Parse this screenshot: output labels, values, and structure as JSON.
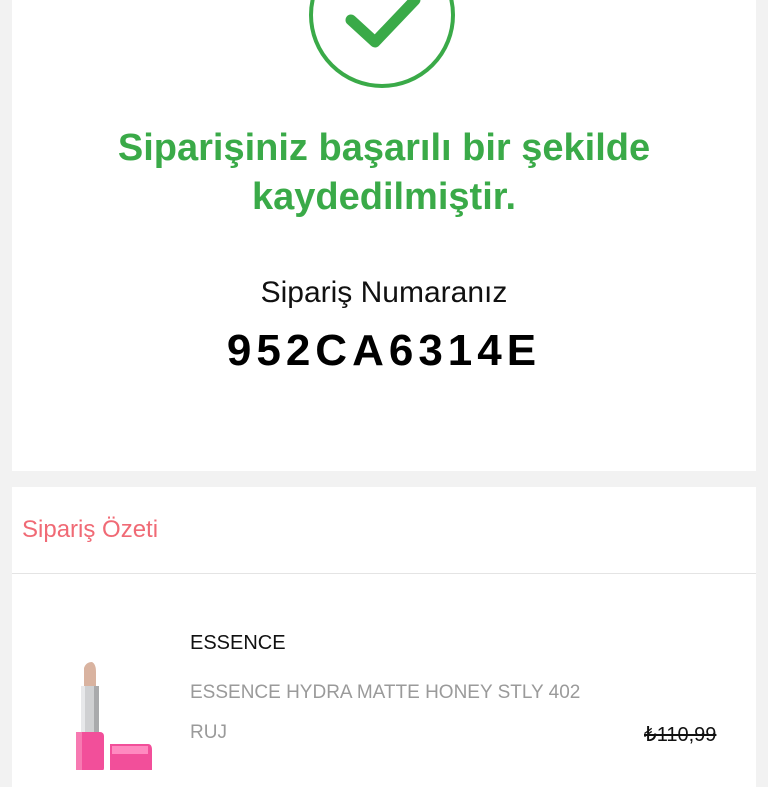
{
  "confirmation": {
    "message": "Siparişiniz başarılı bir şekilde kaydedilmiştir.",
    "order_label": "Sipariş Numaranız",
    "order_number": "952CA6314E"
  },
  "summary": {
    "title": "Sipariş Özeti",
    "items": [
      {
        "brand": "ESSENCE",
        "name": "ESSENCE HYDRA MATTE HONEY STLY 402 RUJ",
        "old_price": "₺110,99"
      }
    ]
  },
  "colors": {
    "success": "#3aaa48",
    "accent": "#f06a75",
    "background": "#f2f2f2"
  },
  "icons": {
    "success": "check-circle-icon",
    "product": "lipstick-image"
  }
}
